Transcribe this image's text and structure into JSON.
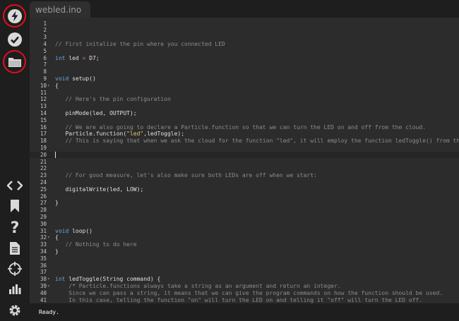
{
  "tab": {
    "filename": "webled.ino"
  },
  "status": {
    "text": "Ready."
  },
  "sidebar": {
    "top": [
      "flash-icon",
      "verify-icon",
      "folder-icon"
    ],
    "bottom": [
      "code-icon",
      "libraries-icon",
      "help-icon",
      "docs-icon",
      "devices-icon",
      "console-icon",
      "settings-icon"
    ]
  },
  "colors": {
    "comment": "#8c8c8c",
    "keyword": "#6aa6d9",
    "number": "#c7d76a",
    "string": "#e6c877",
    "background": "#2c2c2c",
    "annotation": "#e0101a"
  },
  "code_lines": [
    {
      "n": "1"
    },
    {
      "n": "2"
    },
    {
      "n": "3"
    },
    {
      "n": "4",
      "t": [
        [
          "c",
          "// First initalize the pin where you connected LED"
        ]
      ]
    },
    {
      "n": "5"
    },
    {
      "n": "6",
      "t": [
        [
          "k",
          "int"
        ],
        [
          "p",
          " led "
        ],
        [
          "o",
          "="
        ],
        [
          "p",
          " D7;"
        ]
      ]
    },
    {
      "n": "7"
    },
    {
      "n": "8"
    },
    {
      "n": "9",
      "t": [
        [
          "k",
          "void"
        ],
        [
          "p",
          " setup()"
        ]
      ]
    },
    {
      "n": "10",
      "fold": true,
      "t": [
        [
          "p",
          "{"
        ]
      ]
    },
    {
      "n": "11"
    },
    {
      "n": "12",
      "t": [
        [
          "p",
          "   "
        ],
        [
          "c",
          "// Here's the pin configuration"
        ]
      ]
    },
    {
      "n": "13"
    },
    {
      "n": "14",
      "t": [
        [
          "p",
          "   pinMode(led, OUTPUT);"
        ]
      ]
    },
    {
      "n": "15"
    },
    {
      "n": "16",
      "t": [
        [
          "p",
          "   "
        ],
        [
          "c",
          "// We are also going to declare a Particle.function so that we can turn the LED on and off from the cloud."
        ]
      ]
    },
    {
      "n": "17",
      "t": [
        [
          "p",
          "   Particle.function("
        ],
        [
          "s",
          "\"led\""
        ],
        [
          "p",
          ",ledToggle);"
        ]
      ]
    },
    {
      "n": "18",
      "t": [
        [
          "p",
          "   "
        ],
        [
          "c",
          "// This is saying that when we ask the cloud for the function \"led\", it will employ the function ledToggle() from this app."
        ]
      ]
    },
    {
      "n": "19"
    },
    {
      "n": "20",
      "active": true,
      "cursor": true
    },
    {
      "n": "21"
    },
    {
      "n": "22"
    },
    {
      "n": "23",
      "t": [
        [
          "p",
          "   "
        ],
        [
          "c",
          "// For good measure, let's also make sure both LEDs are off when we start:"
        ]
      ]
    },
    {
      "n": "24"
    },
    {
      "n": "25",
      "t": [
        [
          "p",
          "   digitalWrite(led, LOW);"
        ]
      ]
    },
    {
      "n": "26"
    },
    {
      "n": "27",
      "t": [
        [
          "p",
          "}"
        ]
      ]
    },
    {
      "n": "28"
    },
    {
      "n": "29"
    },
    {
      "n": "30"
    },
    {
      "n": "31",
      "t": [
        [
          "k",
          "void"
        ],
        [
          "p",
          " loop()"
        ]
      ]
    },
    {
      "n": "32",
      "fold": true,
      "t": [
        [
          "p",
          "{"
        ]
      ]
    },
    {
      "n": "33",
      "t": [
        [
          "p",
          "   "
        ],
        [
          "c",
          "// Nothing to do here"
        ]
      ]
    },
    {
      "n": "34",
      "t": [
        [
          "p",
          "}"
        ]
      ]
    },
    {
      "n": "35"
    },
    {
      "n": "36"
    },
    {
      "n": "37"
    },
    {
      "n": "38",
      "fold": true,
      "t": [
        [
          "k",
          "int"
        ],
        [
          "p",
          " ledToggle(String command) {"
        ]
      ]
    },
    {
      "n": "39",
      "fold": true,
      "t": [
        [
          "p",
          "    "
        ],
        [
          "c",
          "/* Particle.functions always take a string as an argument and return an integer."
        ]
      ]
    },
    {
      "n": "40",
      "t": [
        [
          "c",
          "    Since we can pass a string, it means that we can give the program commands on how the function should be used."
        ]
      ]
    },
    {
      "n": "41",
      "t": [
        [
          "c",
          "    In this case, telling the function \"on\" will turn the LED on and telling it \"off\" will turn the LED off."
        ]
      ]
    }
  ]
}
